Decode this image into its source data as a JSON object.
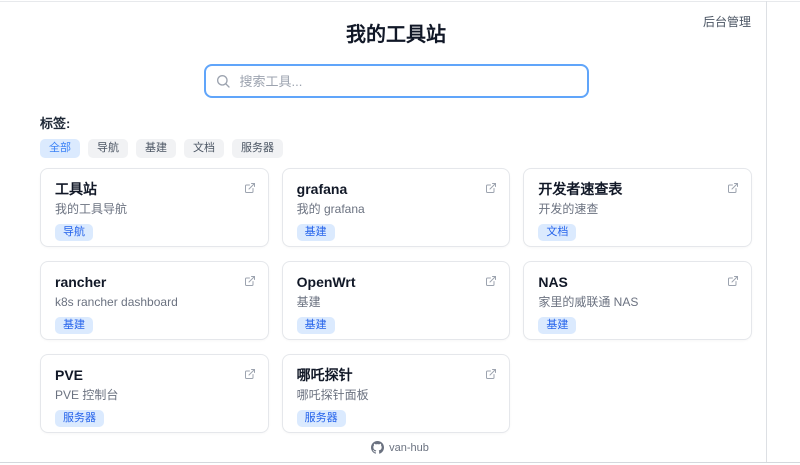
{
  "page": {
    "title": "我的工具站",
    "admin_link": "后台管理",
    "footer_label": "van-hub"
  },
  "search": {
    "placeholder": "搜索工具..."
  },
  "tags": {
    "label": "标签:",
    "items": [
      {
        "label": "全部",
        "active": true
      },
      {
        "label": "导航",
        "active": false
      },
      {
        "label": "基建",
        "active": false
      },
      {
        "label": "文档",
        "active": false
      },
      {
        "label": "服务器",
        "active": false
      }
    ]
  },
  "cards": [
    {
      "title": "工具站",
      "description": "我的工具导航",
      "tag": "导航"
    },
    {
      "title": "grafana",
      "description": "我的 grafana",
      "tag": "基建"
    },
    {
      "title": "开发者速查表",
      "description": "开发的速查",
      "tag": "文档"
    },
    {
      "title": "rancher",
      "description": "k8s rancher dashboard",
      "tag": "基建"
    },
    {
      "title": "OpenWrt",
      "description": "基建",
      "tag": "基建"
    },
    {
      "title": "NAS",
      "description": "家里的威联通 NAS",
      "tag": "基建"
    },
    {
      "title": "PVE",
      "description": "PVE 控制台",
      "tag": "服务器"
    },
    {
      "title": "哪吒探针",
      "description": "哪吒探针面板",
      "tag": "服务器"
    }
  ],
  "colors": {
    "accent_blue": "#3b82f6",
    "search_border": "#60a5fa",
    "pill_blue_bg": "#dbeafe",
    "pill_blue_text": "#2563eb",
    "pill_gray_bg": "#f1f2f4",
    "pill_gray_text": "#4b5563",
    "card_border": "#e5e7eb",
    "muted_text": "#6b7280"
  }
}
